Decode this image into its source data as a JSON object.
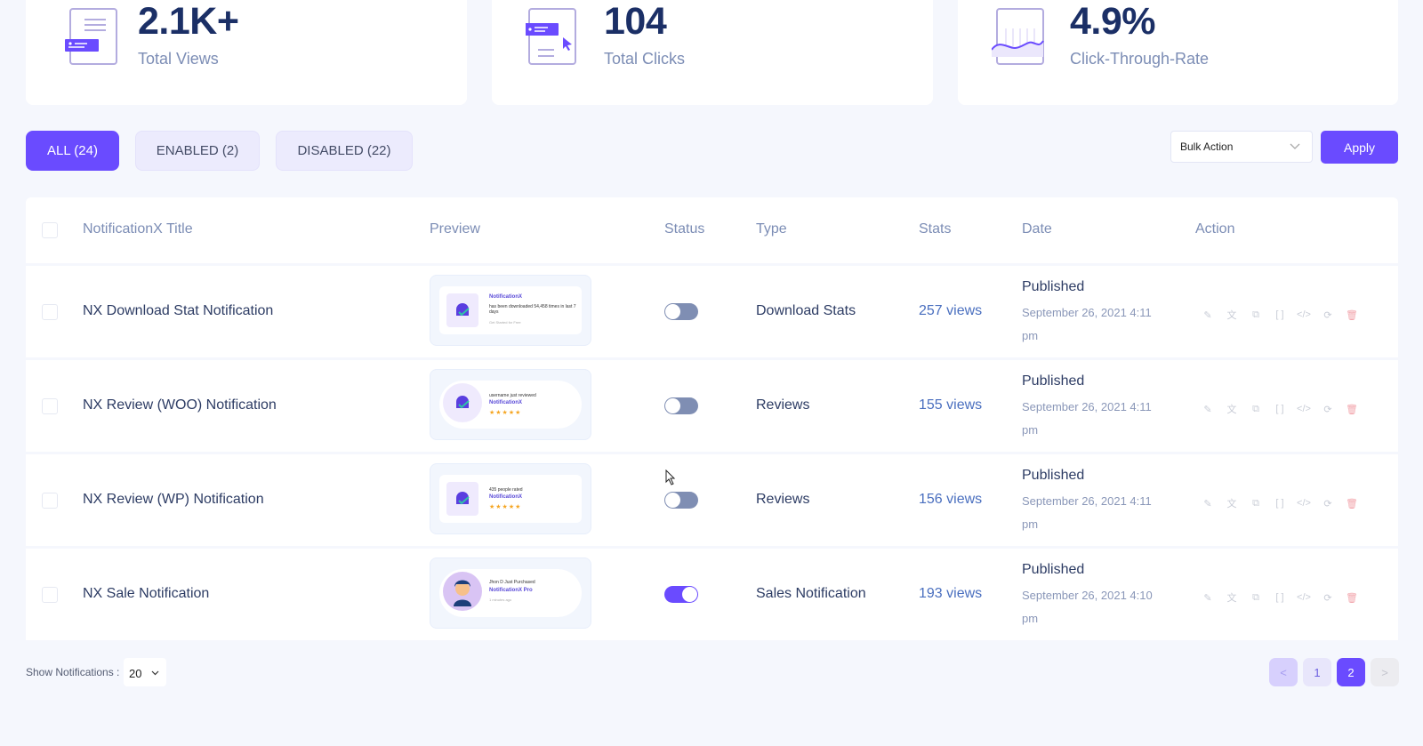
{
  "stats": [
    {
      "value": "2.1K+",
      "label": "Total Views",
      "icon": "views-document-icon"
    },
    {
      "value": "104",
      "label": "Total Clicks",
      "icon": "clicks-document-icon"
    },
    {
      "value": "4.9%",
      "label": "Click-Through-Rate",
      "icon": "ctr-chart-icon"
    }
  ],
  "filters": {
    "all": "ALL (24)",
    "enabled": "ENABLED (2)",
    "disabled": "DISABLED (22)"
  },
  "bulk": {
    "selected": "Bulk Action",
    "apply": "Apply"
  },
  "table": {
    "headers": {
      "title": "NotificationX Title",
      "preview": "Preview",
      "status": "Status",
      "type": "Type",
      "stats": "Stats",
      "date": "Date",
      "action": "Action"
    },
    "rows": [
      {
        "title": "NX Download Stat Notification",
        "preview": {
          "line1": "NotificationX",
          "line2": "has been downloaded 54,458 times in last 7 days",
          "line3": "Get Started for Free"
        },
        "enabled": false,
        "type": "Download Stats",
        "stats": "257 views",
        "status": "Published",
        "date": "September 26, 2021 4:11 pm"
      },
      {
        "title": "NX Review (WOO) Notification",
        "preview": {
          "line1": "username just reviewed",
          "line2": "NotificationX",
          "stars": "★★★★★"
        },
        "enabled": false,
        "type": "Reviews",
        "stats": "155 views",
        "status": "Published",
        "date": "September 26, 2021 4:11 pm"
      },
      {
        "title": "NX Review (WP) Notification",
        "preview": {
          "line1": "435 people rated",
          "line2": "NotificationX",
          "stars": "★★★★★"
        },
        "enabled": false,
        "type": "Reviews",
        "stats": "156 views",
        "status": "Published",
        "date": "September 26, 2021 4:11 pm"
      },
      {
        "title": "NX Sale Notification",
        "preview": {
          "line1": "Jhon D Just Purchased",
          "line2": "NotificationX Pro",
          "line3": "1 minutes ago"
        },
        "enabled": true,
        "type": "Sales Notification",
        "stats": "193 views",
        "status": "Published",
        "date": "September 26, 2021 4:10 pm"
      }
    ],
    "action_icons": [
      "edit-icon",
      "translate-icon",
      "duplicate-icon",
      "shortcode-icon",
      "embed-code-icon",
      "regenerate-icon",
      "delete-icon"
    ]
  },
  "footer": {
    "show_label": "Show Notifications :",
    "per_page": "20",
    "pagination": {
      "prev": "<",
      "pages": [
        "1",
        "2"
      ],
      "current": "2",
      "next": ">"
    }
  },
  "colors": {
    "accent": "#6a4bff",
    "heading": "#1b2f66",
    "muted": "#7c8db5",
    "link": "#4a6fbf"
  }
}
